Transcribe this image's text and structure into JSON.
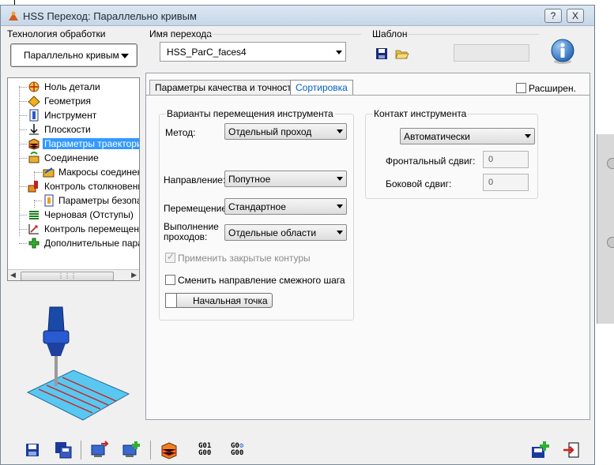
{
  "window": {
    "title": "HSS Переход: Параллельно кривым",
    "help_button": "?",
    "close_button": "X"
  },
  "header": {
    "technology_label": "Технология обработки",
    "technology_value": "Параллельно кривым",
    "step_name_label": "Имя перехода",
    "step_name_value": "HSS_ParC_faces4",
    "template_label": "Шаблон",
    "template_value": ""
  },
  "tree": {
    "items": [
      {
        "label": "Ноль детали",
        "icon": "zero-point-icon"
      },
      {
        "label": "Геометрия",
        "icon": "geometry-icon"
      },
      {
        "label": "Инструмент",
        "icon": "tool-icon"
      },
      {
        "label": "Плоскости",
        "icon": "planes-icon"
      },
      {
        "label": "Параметры траектори",
        "icon": "toolpath-params-icon"
      },
      {
        "label": "Соединение",
        "icon": "link-icon"
      },
      {
        "label": "Макросы соединен",
        "icon": "link-macros-icon"
      },
      {
        "label": "Контроль столкновени",
        "icon": "collision-control-icon"
      },
      {
        "label": "Параметры безопа",
        "icon": "safety-params-icon"
      },
      {
        "label": "Черновая (Отступы)",
        "icon": "roughing-icon"
      },
      {
        "label": "Контроль перемещени",
        "icon": "motion-control-icon"
      },
      {
        "label": "Дополнительные пара",
        "icon": "additional-params-icon"
      }
    ],
    "selected_index": 4
  },
  "tabs": {
    "quality": "Параметры качества и точности",
    "sorting": "Сортировка"
  },
  "extended_label": "Расширен.",
  "movement_group": {
    "title": "Варианты перемещения инструмента",
    "method_label": "Метод:",
    "method_value": "Отдельный проход",
    "direction_label": "Направление:",
    "direction_value": "Попутное",
    "movement_label": "Перемещение:",
    "movement_value": "Стандартное",
    "passes_label_1": "Выполнение",
    "passes_label_2": "проходов:",
    "passes_value": "Отдельные области",
    "apply_closed_label": "Применить закрытые контуры",
    "change_direction_label": "Сменить направление смежного шага",
    "start_point_label": "Начальная точка"
  },
  "contact_group": {
    "title": "Контакт инструмента",
    "mode_value": "Автоматически",
    "front_shift_label": "Фронтальный сдвиг:",
    "front_shift_value": "0",
    "side_shift_label": "Боковой сдвиг:",
    "side_shift_value": "0"
  },
  "toolbar": {
    "gcode_1_top": "G01",
    "gcode_1_bottom": "G00",
    "gcode_2_top": "G0",
    "gcode_2_bottom": "G00"
  },
  "colors": {
    "selection": "#3399ff",
    "titlebar": "#c6d6e8",
    "accent_tab": "#0060c0"
  }
}
